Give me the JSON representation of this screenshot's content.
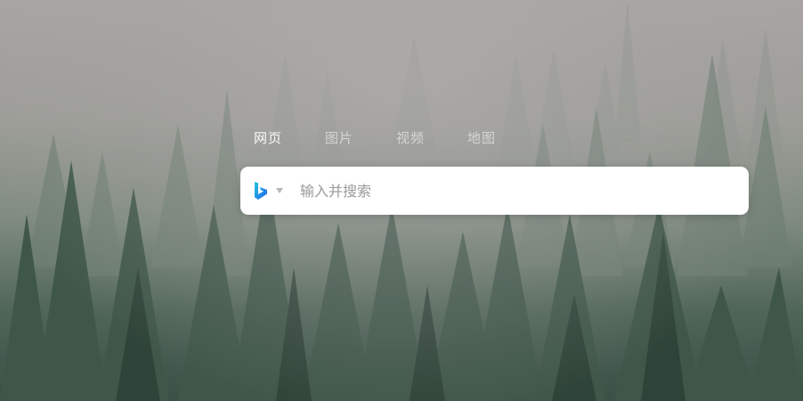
{
  "tabs": [
    {
      "label": "网页",
      "active": true
    },
    {
      "label": "图片",
      "active": false
    },
    {
      "label": "视频",
      "active": false
    },
    {
      "label": "地图",
      "active": false
    }
  ],
  "search": {
    "engine_icon": "bing-logo-icon",
    "dropdown_icon": "caret-down-icon",
    "placeholder": "输入并搜索",
    "value": ""
  },
  "background": {
    "description_icon": "forest-wallpaper"
  },
  "colors": {
    "search_bg": "#ffffff",
    "tab_active": "#f2f2f2",
    "tab_inactive": "#c9c9c9",
    "bing_blue": "#1e90ff",
    "bing_cyan": "#26c6da"
  }
}
